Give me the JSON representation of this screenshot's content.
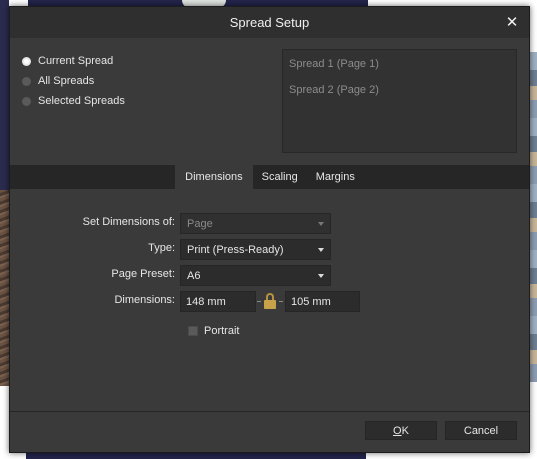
{
  "dialog": {
    "title": "Spread Setup",
    "close_icon": "close-icon"
  },
  "spread_scope": {
    "options": [
      {
        "label": "Current Spread",
        "checked": true
      },
      {
        "label": "All Spreads",
        "checked": false
      },
      {
        "label": "Selected Spreads",
        "checked": false
      }
    ]
  },
  "spread_list": {
    "items": [
      "Spread 1 (Page 1)",
      "Spread 2 (Page 2)"
    ]
  },
  "tabs": {
    "items": [
      "Dimensions",
      "Scaling",
      "Margins"
    ],
    "active": "Dimensions"
  },
  "form": {
    "set_dimensions_of": {
      "label": "Set Dimensions of:",
      "value": "Page",
      "disabled": true
    },
    "type": {
      "label": "Type:",
      "value": "Print (Press-Ready)"
    },
    "page_preset": {
      "label": "Page Preset:",
      "value": "A6"
    },
    "dimensions": {
      "label": "Dimensions:",
      "width": "148 mm",
      "height": "105 mm",
      "lock_icon": "lock-icon"
    },
    "portrait": {
      "label": "Portrait",
      "checked": false
    }
  },
  "footer": {
    "ok_mnemonic": "O",
    "ok_rest": "K",
    "cancel_label": "Cancel"
  },
  "colors": {
    "dialog_bg": "#3a3a3a",
    "titlebar_bg": "#2f2f2f",
    "tabbar_bg": "#262626",
    "lock_accent": "#c8a24a"
  }
}
